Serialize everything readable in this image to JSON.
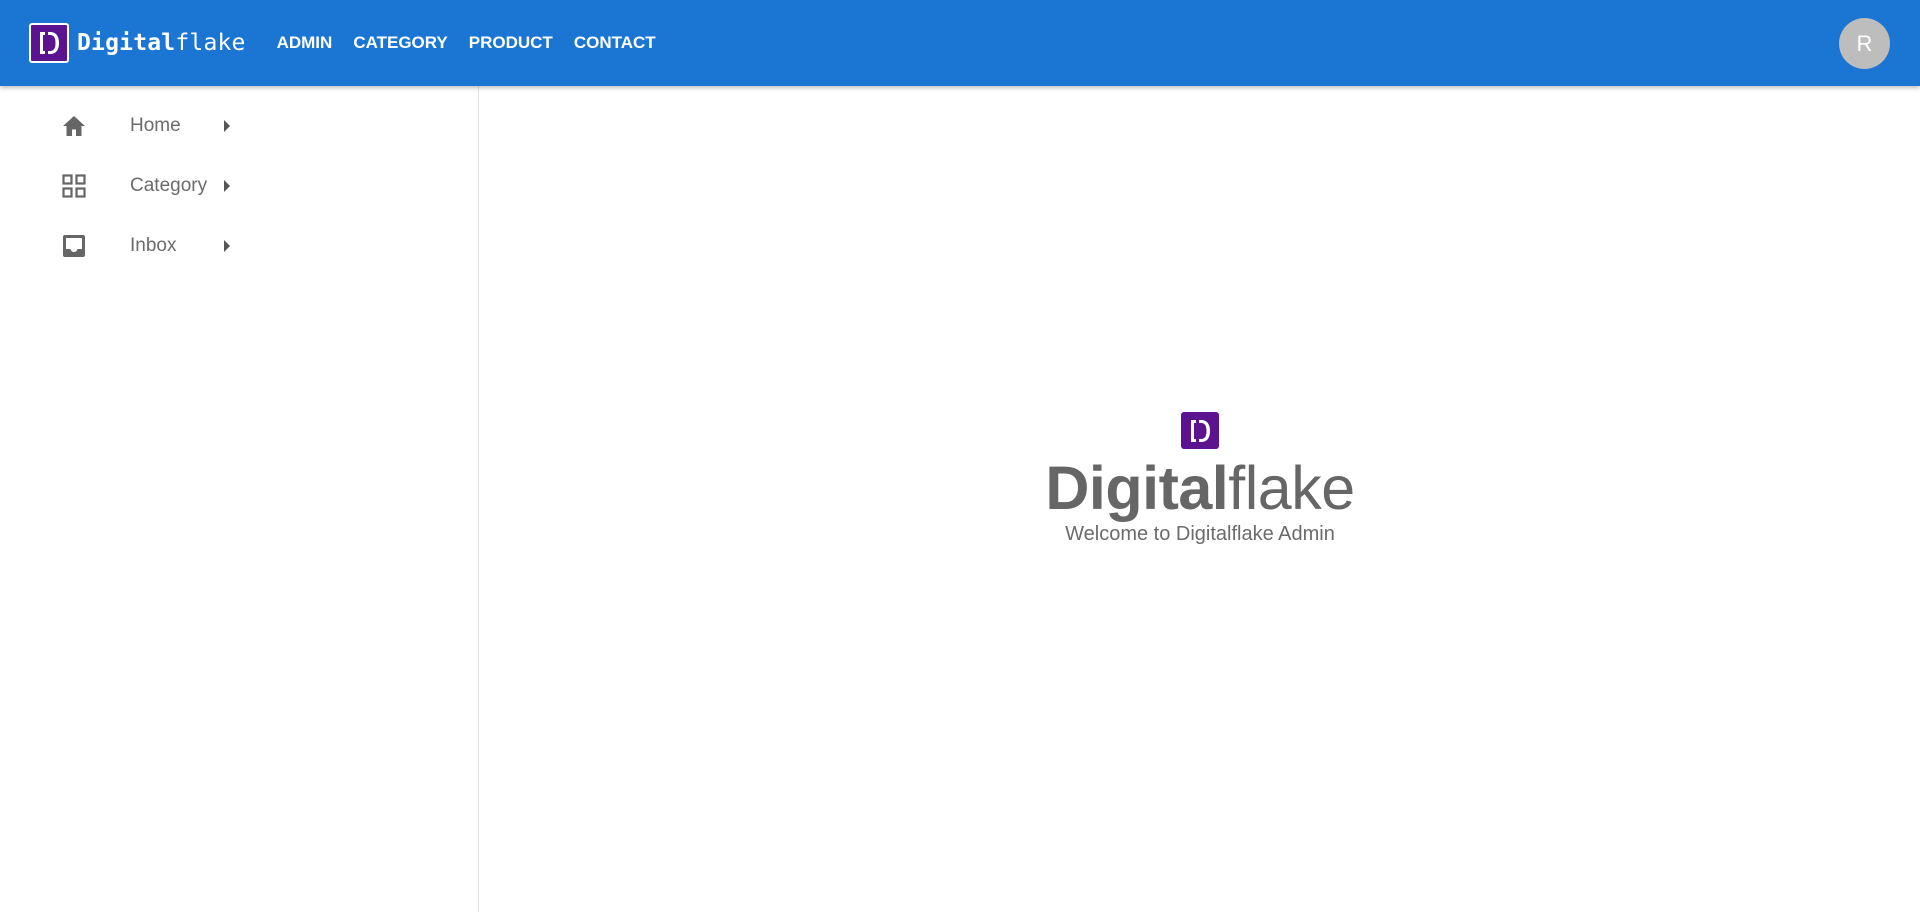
{
  "header": {
    "brand_bold": "Digital",
    "brand_light": "flake",
    "nav": [
      "ADMIN",
      "CATEGORY",
      "PRODUCT",
      "CONTACT"
    ],
    "avatar_initial": "R",
    "color": "#1b76d3",
    "logo_color": "#5b138f",
    "logo_icon": "digitalflake-logo"
  },
  "sidebar": {
    "items": [
      {
        "label": "Home",
        "icon": "home-icon"
      },
      {
        "label": "Category",
        "icon": "grid-icon"
      },
      {
        "label": "Inbox",
        "icon": "inbox-icon"
      }
    ]
  },
  "main": {
    "title_bold": "Digital",
    "title_light": "flake",
    "subtitle": "Welcome to Digitalflake Admin"
  }
}
